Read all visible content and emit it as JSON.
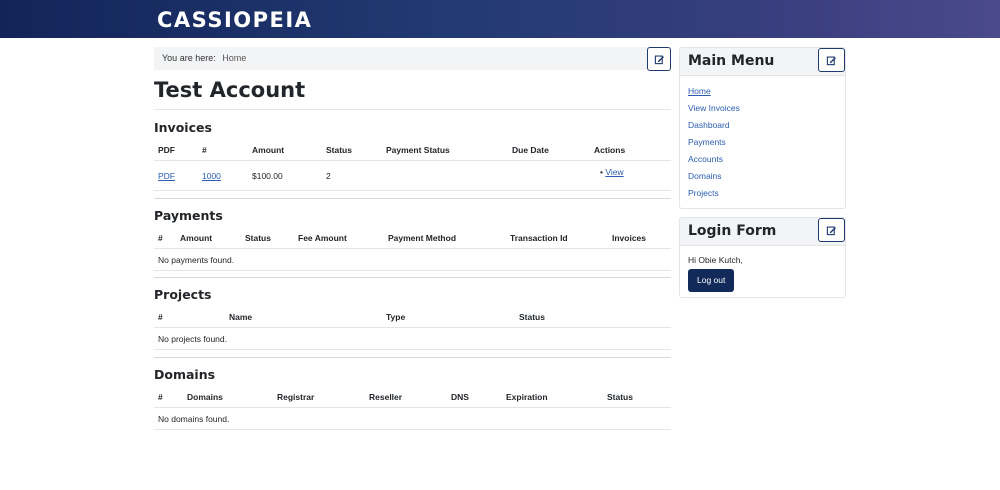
{
  "header": {
    "brand": "CASSIOPEIA"
  },
  "breadcrumb": {
    "label": "You are here:",
    "current": "Home"
  },
  "page": {
    "title": "Test Account"
  },
  "invoices": {
    "heading": "Invoices",
    "columns": [
      "PDF",
      "#",
      "Amount",
      "Status",
      "Payment Status",
      "Due Date",
      "Actions"
    ],
    "row": {
      "pdf": "PDF",
      "number": "1000",
      "amount": "$100.00",
      "status": "2",
      "payment_status": "",
      "due_date": "",
      "action": "View"
    }
  },
  "payments": {
    "heading": "Payments",
    "columns": [
      "#",
      "Amount",
      "Status",
      "Fee Amount",
      "Payment Method",
      "Transaction Id",
      "Invoices"
    ],
    "empty": "No payments found."
  },
  "projects": {
    "heading": "Projects",
    "columns": [
      "#",
      "Name",
      "Type",
      "Status"
    ],
    "empty": "No projects found."
  },
  "domains": {
    "heading": "Domains",
    "columns": [
      "#",
      "Domains",
      "Registrar",
      "Reseller",
      "DNS",
      "Expiration",
      "Status"
    ],
    "empty": "No domains found."
  },
  "main_menu": {
    "heading": "Main Menu",
    "items": [
      "Home",
      "View Invoices",
      "Dashboard",
      "Payments",
      "Accounts",
      "Domains",
      "Projects"
    ]
  },
  "login_form": {
    "heading": "Login Form",
    "greeting": "Hi Obie Kutch,",
    "logout_label": "Log out"
  },
  "icons": {
    "edit": "edit-icon"
  },
  "colors": {
    "accent": "#112a5a",
    "link": "#2a5db0"
  }
}
